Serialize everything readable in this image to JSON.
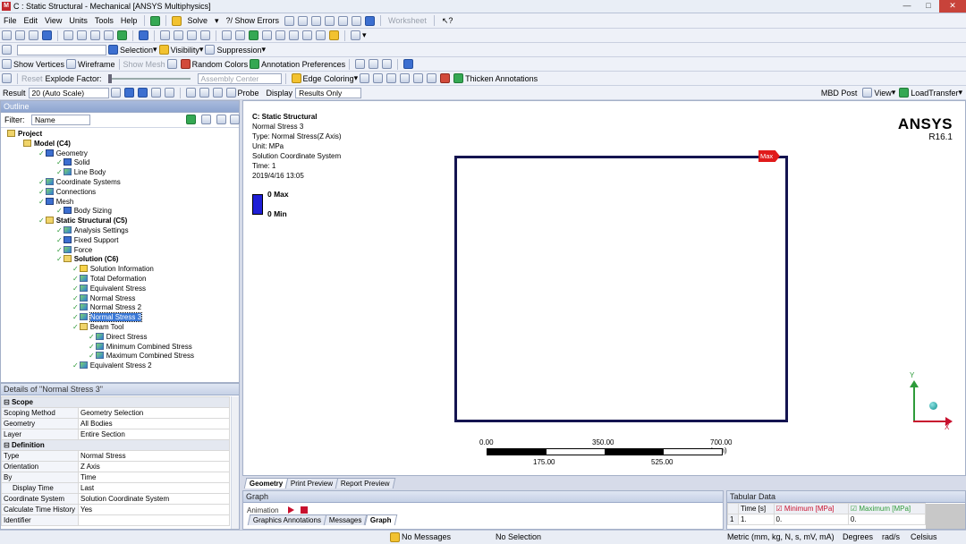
{
  "window": {
    "title": "C : Static Structural - Mechanical [ANSYS Multiphysics]"
  },
  "menu": [
    "File",
    "Edit",
    "View",
    "Units",
    "Tools",
    "Help"
  ],
  "toolbar1": {
    "solve": "Solve",
    "show_errors": "?/ Show Errors",
    "worksheet": "Worksheet"
  },
  "toolbar3": {
    "selection": "Selection",
    "visibility": "Visibility",
    "suppression": "Suppression"
  },
  "toolbar4": {
    "show_vertices": "Show Vertices",
    "wireframe": "Wireframe",
    "show_mesh": "Show Mesh",
    "random_colors": "Random Colors",
    "annotation_prefs": "Annotation Preferences"
  },
  "toolbar5": {
    "reset": "Reset",
    "explode_factor": "Explode Factor:",
    "assembly_center": "Assembly Center",
    "edge_coloring": "Edge Coloring",
    "thicken": "Thicken Annotations"
  },
  "toolbar6": {
    "result": "Result",
    "scale": "20 (Auto Scale)",
    "probe": "Probe",
    "display": "Display",
    "results_only": "Results Only",
    "mbd_post": "MBD Post",
    "view": "View",
    "load_transfer": "LoadTransfer"
  },
  "outline": {
    "title": "Outline",
    "filter_label": "Filter:",
    "filter_value": "Name",
    "items": [
      {
        "label": "Project",
        "x": 6,
        "bold": true,
        "icon": "fold"
      },
      {
        "label": "Model (C4)",
        "x": 24,
        "bold": true,
        "icon": "fold"
      },
      {
        "label": "Geometry",
        "x": 42,
        "icon": "blue"
      },
      {
        "label": "Solid",
        "x": 62,
        "icon": "blue"
      },
      {
        "label": "Line Body",
        "x": 62,
        "icon": "plain"
      },
      {
        "label": "Coordinate Systems",
        "x": 42,
        "icon": "plain"
      },
      {
        "label": "Connections",
        "x": 42,
        "icon": "plain"
      },
      {
        "label": "Mesh",
        "x": 42,
        "icon": "blue"
      },
      {
        "label": "Body Sizing",
        "x": 62,
        "icon": "blue"
      },
      {
        "label": "Static Structural (C5)",
        "x": 42,
        "bold": true,
        "icon": "fold"
      },
      {
        "label": "Analysis Settings",
        "x": 62,
        "icon": "plain"
      },
      {
        "label": "Fixed Support",
        "x": 62,
        "icon": "blue"
      },
      {
        "label": "Force",
        "x": 62,
        "icon": "plain"
      },
      {
        "label": "Solution (C6)",
        "x": 62,
        "bold": true,
        "icon": "fold"
      },
      {
        "label": "Solution Information",
        "x": 80,
        "icon": "info"
      },
      {
        "label": "Total Deformation",
        "x": 80,
        "icon": "res"
      },
      {
        "label": "Equivalent Stress",
        "x": 80,
        "icon": "res"
      },
      {
        "label": "Normal Stress",
        "x": 80,
        "icon": "res"
      },
      {
        "label": "Normal Stress 2",
        "x": 80,
        "icon": "res"
      },
      {
        "label": "Normal Stress 3",
        "x": 80,
        "icon": "res",
        "selected": true
      },
      {
        "label": "Beam Tool",
        "x": 80,
        "icon": "fold"
      },
      {
        "label": "Direct Stress",
        "x": 98,
        "icon": "res"
      },
      {
        "label": "Minimum Combined Stress",
        "x": 98,
        "icon": "res"
      },
      {
        "label": "Maximum Combined Stress",
        "x": 98,
        "icon": "res"
      },
      {
        "label": "Equivalent Stress 2",
        "x": 80,
        "icon": "res"
      }
    ]
  },
  "details": {
    "title": "Details of \"Normal Stress 3\"",
    "rows": [
      {
        "group": "Scope"
      },
      {
        "k": "Scoping Method",
        "v": "Geometry Selection"
      },
      {
        "k": "Geometry",
        "v": "All Bodies"
      },
      {
        "k": "Layer",
        "v": "Entire Section"
      },
      {
        "group": "Definition"
      },
      {
        "k": "Type",
        "v": "Normal Stress"
      },
      {
        "k": "Orientation",
        "v": "Z Axis"
      },
      {
        "k": "By",
        "v": "Time"
      },
      {
        "k": "Display Time",
        "v": "Last",
        "indent": true
      },
      {
        "k": "Coordinate System",
        "v": "Solution Coordinate System"
      },
      {
        "k": "Calculate Time History",
        "v": "Yes"
      },
      {
        "k": "Identifier",
        "v": ""
      }
    ]
  },
  "viewport": {
    "info": [
      "C: Static Structural",
      "Normal Stress 3",
      "Type: Normal Stress(Z Axis)",
      "Unit: MPa",
      "Solution Coordinate System",
      "Time: 1",
      "2019/4/16 13:05"
    ],
    "legend_max": "0 Max",
    "legend_min": "0 Min",
    "legend_color": "#1f1fd6",
    "brand": "ANSYS",
    "version": "R16.1",
    "max_tag": "Max",
    "scale_top": [
      "0.00",
      "350.00",
      "700.00 (mm)"
    ],
    "scale_bottom": [
      "175.00",
      "525.00"
    ],
    "tabs": [
      "Geometry",
      "Print Preview",
      "Report Preview"
    ],
    "axis_y": "Y",
    "axis_x": "X"
  },
  "graph": {
    "title": "Graph",
    "animation": "Animation",
    "tabs": [
      "Graphics Annotations",
      "Messages",
      "Graph"
    ]
  },
  "tabular": {
    "title": "Tabular Data",
    "headers": [
      "Time [s]",
      "Minimum [MPa]",
      "Maximum [MPa]"
    ],
    "row": [
      "1",
      "1.",
      "0.",
      "0."
    ]
  },
  "status": {
    "messages": "No Messages",
    "selection": "No Selection",
    "units": "Metric (mm, kg, N, s, mV, mA)",
    "angle": "Degrees",
    "rate": "rad/s",
    "temp": "Celsius"
  }
}
